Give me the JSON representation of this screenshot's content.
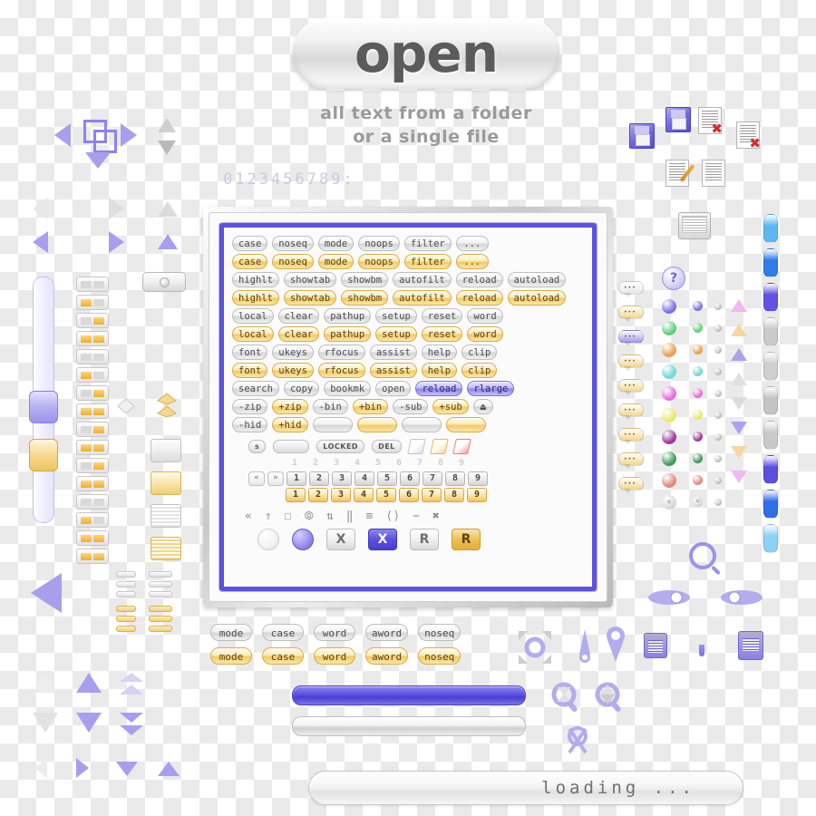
{
  "header": {
    "title": "open",
    "subtitle_line1": "all text from a folder",
    "subtitle_line2": "or a single file",
    "lcd_digits": "0123456789:"
  },
  "panel": {
    "button_rows": [
      {
        "style": "grey",
        "labels": [
          "case",
          "noseq",
          "mode",
          "noops",
          "filter",
          "..."
        ]
      },
      {
        "style": "gold",
        "labels": [
          "case",
          "noseq",
          "mode",
          "noops",
          "filter",
          "..."
        ]
      },
      {
        "style": "grey",
        "labels": [
          "highlt",
          "showtab",
          "showbm",
          "autofilt",
          "reload",
          "autoload"
        ]
      },
      {
        "style": "gold",
        "labels": [
          "highlt",
          "showtab",
          "showbm",
          "autofilt",
          "reload",
          "autoload"
        ]
      },
      {
        "style": "grey",
        "labels": [
          "local",
          "clear",
          "pathup",
          "setup",
          "reset",
          "word"
        ]
      },
      {
        "style": "gold",
        "labels": [
          "local",
          "clear",
          "pathup",
          "setup",
          "reset",
          "word"
        ]
      },
      {
        "style": "grey",
        "labels": [
          "font",
          "ukeys",
          "rfocus",
          "assist",
          "help",
          "clip"
        ]
      },
      {
        "style": "gold",
        "labels": [
          "font",
          "ukeys",
          "rfocus",
          "assist",
          "help",
          "clip"
        ]
      }
    ],
    "search_row": {
      "labels": [
        "search",
        "copy",
        "bookmk",
        "open",
        "reload",
        "rlarge"
      ],
      "styles": [
        "grey",
        "grey",
        "grey",
        "grey",
        "blue",
        "blue"
      ]
    },
    "zip_row": {
      "labels": [
        "-zip",
        "+zip",
        "-bin",
        "+bin",
        "-sub",
        "+sub"
      ],
      "styles": [
        "grey",
        "gold",
        "grey",
        "gold",
        "grey",
        "gold"
      ],
      "eject_icon": "eject-icon"
    },
    "hid_row": {
      "labels": [
        "-hid",
        "+hid",
        "",
        "",
        "",
        ""
      ],
      "styles": [
        "grey",
        "gold",
        "grey",
        "gold",
        "grey",
        "gold"
      ]
    },
    "status_row": {
      "s_label": "s",
      "blank_label": "",
      "locked_label": "LOCKED",
      "del_label": "DEL",
      "corner_colors": [
        "#e2e2e2",
        "#f6dc9c",
        "#f0a2a2"
      ]
    },
    "keypad": {
      "digits": [
        "1",
        "2",
        "3",
        "4",
        "5",
        "6",
        "7",
        "8",
        "9"
      ],
      "nav_prev": "«",
      "nav_next": "»",
      "row_states": [
        "ghost",
        "grey",
        "gold"
      ]
    },
    "media_icons": [
      "rewind-icon",
      "collapse-up-icon",
      "stop-icon",
      "loading-spinner-icon",
      "refresh-icon",
      "pause-icon",
      "equals-icon",
      "code-brackets-icon",
      "minus-icon",
      "close-x-icon"
    ],
    "shape_row": {
      "orbs": [
        "white-orb",
        "blue-orb"
      ],
      "buttons": [
        {
          "label": "X",
          "style": "white"
        },
        {
          "label": "X",
          "style": "blue"
        },
        {
          "label": "R",
          "style": "white"
        },
        {
          "label": "R",
          "style": "gold"
        }
      ]
    }
  },
  "bottom_buttons": {
    "rows": [
      {
        "style": "grey",
        "labels": [
          "mode",
          "case",
          "word",
          "aword",
          "noseq"
        ]
      },
      {
        "style": "gold",
        "labels": [
          "mode",
          "case",
          "word",
          "aword",
          "noseq"
        ]
      }
    ]
  },
  "progress": {
    "blue_bar": "blue-progress-bar",
    "grey_bar": "grey-progress-bar",
    "loading_text": "loading ..."
  },
  "left_tools": {
    "slider": {
      "name": "vertical-slider",
      "thumb_blue": "slider-thumb-blue",
      "thumb_gold": "slider-thumb-gold"
    },
    "toggle_states": [
      [
        "off",
        "off"
      ],
      [
        "on",
        "off"
      ],
      [
        "off",
        "on"
      ],
      [
        "on",
        "on"
      ],
      [
        "off",
        "off"
      ],
      [
        "on",
        "off"
      ],
      [
        "off",
        "on"
      ],
      [
        "on",
        "on"
      ],
      [
        "off",
        "on"
      ],
      [
        "on",
        "on"
      ],
      [
        "off",
        "on"
      ],
      [
        "on",
        "on"
      ],
      [
        "off",
        "off"
      ],
      [
        "on",
        "off"
      ],
      [
        "on",
        "on"
      ],
      [
        "on",
        "on"
      ]
    ],
    "arrow_icons": [
      "arrow-left-icon",
      "overlap-squares-icon",
      "arrow-right-icon",
      "arrow-down-icon",
      "cone-up-icon",
      "cone-down-icon"
    ],
    "switch_icon": "toggle-switch-icon"
  },
  "right_tools": {
    "file_icons": [
      "floppy-stack-icon",
      "floppy-disk-icon",
      "document-delete-icon",
      "documents-delete-icon",
      "document-edit-icon",
      "document-export-icon"
    ],
    "monitor_icon": "monitor-icon",
    "help_icon": "help-question-icon",
    "orb_colors": [
      "#7b72e8",
      "#63cf7e",
      "#e8a24e",
      "#6fd8dc",
      "#e86fd8",
      "#e8e86f",
      "#a03a9b",
      "#3f9c5a",
      "#e08a7c"
    ],
    "bubble_count": 9,
    "scrollbar_segments": [
      "#5bb8f0",
      "#2f7de8",
      "#6152e2",
      "#c9c9c9",
      "#cfcfcf",
      "#c4c4c4",
      "#c9c9c9",
      "#5b4fe0",
      "#2f6ee8",
      "#8fd0f5"
    ],
    "magnify_icons": [
      "magnifier-icon",
      "eye-left-icon",
      "eye-right-icon"
    ],
    "tool_icons": [
      "move-target-icon",
      "pin-icon",
      "marker-icon",
      "list-panel-icon",
      "key-icon",
      "book-icon",
      "link-icon",
      "link-search-icon",
      "link-broken-icon"
    ]
  }
}
